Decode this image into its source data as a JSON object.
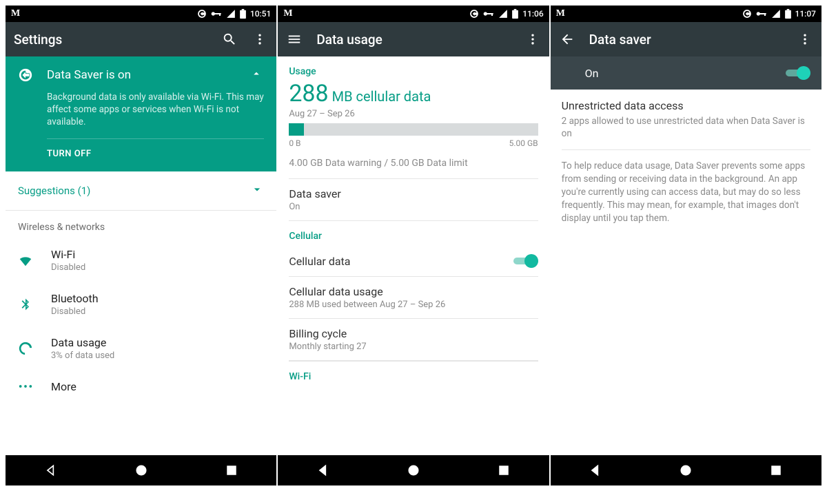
{
  "screens": [
    {
      "status_time": "10:51",
      "appbar_title": "Settings",
      "card": {
        "title": "Data Saver is on",
        "desc": "Background data is only available via Wi-Fi. This may affect some apps or services when Wi-Fi is not available.",
        "turn_off": "TURN OFF"
      },
      "suggestions_label": "Suggestions (1)",
      "section_header": "Wireless & networks",
      "items": [
        {
          "title": "Wi-Fi",
          "sub": "Disabled"
        },
        {
          "title": "Bluetooth",
          "sub": "Disabled"
        },
        {
          "title": "Data usage",
          "sub": "3% of data used"
        },
        {
          "title": "More",
          "sub": ""
        }
      ]
    },
    {
      "status_time": "11:06",
      "appbar_title": "Data usage",
      "usage_label": "Usage",
      "big_num": "288",
      "big_unit": " MB cellular data",
      "date_range": "Aug 27 – Sep 26",
      "bar_min": "0 B",
      "bar_max": "5.00 GB",
      "bar_fill_percent": 6,
      "warn_line": "4.00 GB Data warning / 5.00 GB Data limit",
      "rows": {
        "datasaver": {
          "t": "Data saver",
          "s": "On"
        },
        "cell_header": "Cellular",
        "cell_data": "Cellular data",
        "cell_usage": {
          "t": "Cellular data usage",
          "s": "288 MB used between Aug 27 – Sep 26"
        },
        "billing": {
          "t": "Billing cycle",
          "s": "Monthly starting 27"
        },
        "wifi_header": "Wi-Fi"
      }
    },
    {
      "status_time": "11:07",
      "appbar_title": "Data saver",
      "toggle_label": "On",
      "item": {
        "t": "Unrestricted data access",
        "s": "2 apps allowed to use unrestricted data when Data Saver is on"
      },
      "explain": "To help reduce data usage, Data Saver prevents some apps from sending or receiving data in the background. An app you're currently using can access data, but may do so less frequently. This may mean, for example, that images don't display until you tap them."
    }
  ]
}
